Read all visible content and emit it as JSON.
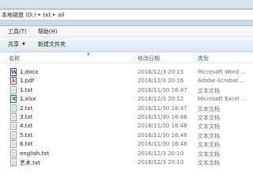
{
  "address": {
    "crumbs": [
      "本地磁盘 (D:)",
      "txt",
      "all"
    ]
  },
  "menu": [
    "工具(T)",
    "帮助(H)"
  ],
  "toolbar": {
    "share": "共享",
    "new_folder": "新建文件夹"
  },
  "columns": {
    "name": "名称",
    "date": "修改日期",
    "type": "类型"
  },
  "files": [
    {
      "name": "1.docx",
      "date": "2016/12/3 20:15",
      "type": "Microsoft Word ...",
      "icon": "docx"
    },
    {
      "name": "1.pdf",
      "date": "2016/12/3 20:16",
      "type": "Adobe Acrobat ...",
      "icon": "pdf"
    },
    {
      "name": "1.txt",
      "date": "2016/11/30 16:47",
      "type": "文本文档",
      "icon": "txt"
    },
    {
      "name": "1.xlsx",
      "date": "2016/12/3 20:12",
      "type": "Microsoft Excel ...",
      "icon": "xlsx"
    },
    {
      "name": "2.txt",
      "date": "2016/11/30 16:47",
      "type": "文本文档",
      "icon": "txt"
    },
    {
      "name": "3.txt",
      "date": "2016/11/30 16:48",
      "type": "文本文档",
      "icon": "txt"
    },
    {
      "name": "4.txt",
      "date": "2016/11/30 16:48",
      "type": "文本文档",
      "icon": "txt"
    },
    {
      "name": "5.txt",
      "date": "2016/11/30 16:48",
      "type": "文本文档",
      "icon": "txt"
    },
    {
      "name": "6.txt",
      "date": "2016/11/30 16:48",
      "type": "文本文档",
      "icon": "txt"
    },
    {
      "name": "english.txt",
      "date": "2016/12/3 20:10",
      "type": "文本文档",
      "icon": "txt"
    },
    {
      "name": "艺术.txt",
      "date": "2016/12/3 20:10",
      "type": "文本文档",
      "icon": "txt"
    }
  ]
}
